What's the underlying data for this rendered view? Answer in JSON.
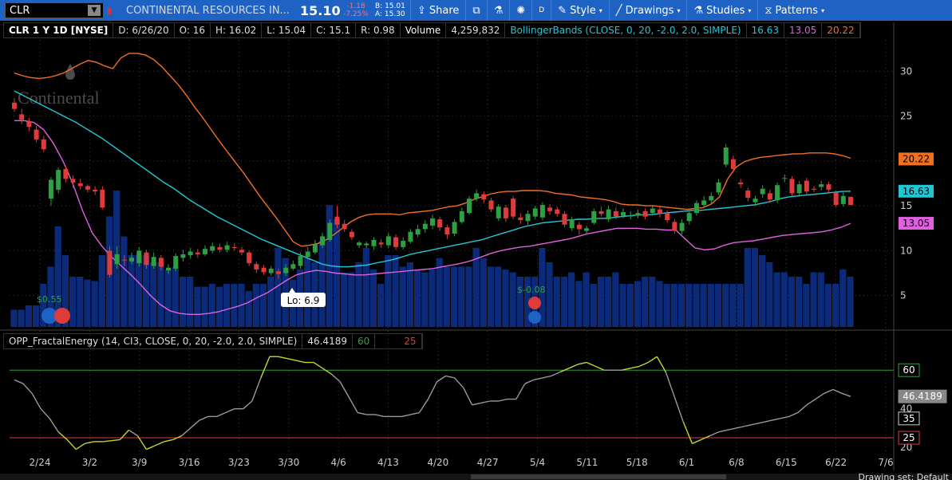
{
  "toolbar": {
    "symbol": "CLR",
    "company": "CONTINENTAL RESOURCES IN...",
    "last": "15.10",
    "change": "-1.18",
    "change_pct": "-7.25%",
    "bid": "B: 15.01",
    "ask": "A: 15.30",
    "share": "Share",
    "period": "D",
    "style": "Style",
    "drawings": "Drawings",
    "studies": "Studies",
    "patterns": "Patterns",
    "colors": {
      "toolbar_bg": "#1e62c4",
      "up": "#2ea043",
      "down": "#e03b3b"
    }
  },
  "infobar": {
    "title": "CLR 1 Y 1D [NYSE]",
    "date": "D: 6/26/20",
    "open": "O: 16",
    "high": "H: 16.02",
    "low": "L: 15.04",
    "close": "C: 15.1",
    "range": "R: 0.98",
    "volume_label": "Volume",
    "volume": "4,259,832",
    "bb_label": "BollingerBands (CLOSE, 0, 20, -2.0, 2.0, SIMPLE)",
    "bb_mid": "16.63",
    "bb_low": "13.05",
    "bb_high": "20.22"
  },
  "lower_study": {
    "label": "OPP_FractalEnergy (14, CI3, CLOSE, 0, 20, -2.0, 2.0, SIMPLE)",
    "value": "46.4189",
    "upper": "60",
    "lower": "25"
  },
  "annotations": {
    "low_bubble": "Lo: 6.9",
    "div1": "$0.55",
    "div2": "$-0.08"
  },
  "bottom": {
    "drawing_set": "Drawing set: Default"
  },
  "chart_data": {
    "type": "candlestick",
    "x_ticks": [
      "2/24",
      "3/2",
      "3/9",
      "3/16",
      "3/23",
      "3/30",
      "4/6",
      "4/13",
      "4/20",
      "4/27",
      "5/4",
      "5/11",
      "5/18",
      "6/1",
      "6/8",
      "6/15",
      "6/22",
      "7/6"
    ],
    "y_ticks": [
      5,
      10,
      15,
      20,
      25,
      30
    ],
    "ylim": [
      1.5,
      33.5
    ],
    "candles": [
      {
        "o": 26.5,
        "c": 25.8,
        "h": 27,
        "l": 25.5
      },
      {
        "o": 25.2,
        "c": 24.6,
        "h": 25.8,
        "l": 24.1
      },
      {
        "o": 24.4,
        "c": 23.8,
        "h": 24.8,
        "l": 23.3
      },
      {
        "o": 23.5,
        "c": 22.4,
        "h": 23.9,
        "l": 22.1
      },
      {
        "o": 22.4,
        "c": 21.3,
        "h": 22.8,
        "l": 21
      },
      {
        "o": 15.8,
        "c": 17.9,
        "h": 18.2,
        "l": 15
      },
      {
        "o": 16.8,
        "c": 19,
        "h": 19.3,
        "l": 16.4
      },
      {
        "o": 19.1,
        "c": 18,
        "h": 19.5,
        "l": 17.6
      },
      {
        "o": 18,
        "c": 17.6,
        "h": 18.4,
        "l": 17
      },
      {
        "o": 17.5,
        "c": 17.2,
        "h": 18,
        "l": 16.8
      },
      {
        "o": 17.2,
        "c": 16.8,
        "h": 17.4,
        "l": 16.5
      },
      {
        "o": 16.8,
        "c": 16.6,
        "h": 17.2,
        "l": 16.2
      },
      {
        "o": 16.8,
        "c": 14.8,
        "h": 17.2,
        "l": 14.6
      },
      {
        "o": 10,
        "c": 7.3,
        "h": 10.5,
        "l": 7
      },
      {
        "o": 8.5,
        "c": 9.6,
        "h": 10.5,
        "l": 8
      },
      {
        "o": 9,
        "c": 8.9,
        "h": 9.5,
        "l": 8.3
      },
      {
        "o": 8.8,
        "c": 9.2,
        "h": 9.8,
        "l": 8.5
      },
      {
        "o": 8.6,
        "c": 10,
        "h": 10.4,
        "l": 8.2
      },
      {
        "o": 9.8,
        "c": 8.4,
        "h": 10.1,
        "l": 8
      },
      {
        "o": 8.3,
        "c": 9.3,
        "h": 9.8,
        "l": 8
      },
      {
        "o": 9.2,
        "c": 8.2,
        "h": 9.5,
        "l": 7.8
      },
      {
        "o": 7.8,
        "c": 8.1,
        "h": 8.5,
        "l": 7.4
      },
      {
        "o": 8,
        "c": 9.4,
        "h": 9.7,
        "l": 7.7
      },
      {
        "o": 9.2,
        "c": 9.6,
        "h": 10.1,
        "l": 8.8
      },
      {
        "o": 9.5,
        "c": 9.9,
        "h": 10.3,
        "l": 9.1
      },
      {
        "o": 9.8,
        "c": 9.6,
        "h": 10.2,
        "l": 9.2
      },
      {
        "o": 9.6,
        "c": 10.2,
        "h": 10.6,
        "l": 9.4
      },
      {
        "o": 10,
        "c": 10.5,
        "h": 10.9,
        "l": 9.7
      },
      {
        "o": 10.4,
        "c": 10.1,
        "h": 10.8,
        "l": 9.8
      },
      {
        "o": 10.1,
        "c": 10.6,
        "h": 11,
        "l": 9.8
      },
      {
        "o": 10.4,
        "c": 10.3,
        "h": 10.8,
        "l": 10
      },
      {
        "o": 10.1,
        "c": 9.8,
        "h": 10.4,
        "l": 9.5
      },
      {
        "o": 9.8,
        "c": 8.6,
        "h": 10,
        "l": 8.3
      },
      {
        "o": 8.5,
        "c": 7.9,
        "h": 8.8,
        "l": 7.5
      },
      {
        "o": 8.1,
        "c": 7.6,
        "h": 8.4,
        "l": 7.3
      },
      {
        "o": 7.5,
        "c": 8,
        "h": 8.3,
        "l": 7.2
      },
      {
        "o": 7.7,
        "c": 7.4,
        "h": 8,
        "l": 6.9
      },
      {
        "o": 7.5,
        "c": 8.1,
        "h": 8.5,
        "l": 7.2
      },
      {
        "o": 8,
        "c": 8.5,
        "h": 8.9,
        "l": 7.8
      },
      {
        "o": 8.3,
        "c": 9.4,
        "h": 9.8,
        "l": 8
      },
      {
        "o": 9.3,
        "c": 9.9,
        "h": 10.4,
        "l": 9
      },
      {
        "o": 9.8,
        "c": 10.7,
        "h": 11.2,
        "l": 9.6
      },
      {
        "o": 10.6,
        "c": 11.6,
        "h": 12,
        "l": 10.3
      },
      {
        "o": 11.2,
        "c": 13.1,
        "h": 13.5,
        "l": 11
      },
      {
        "o": 13.8,
        "c": 12.9,
        "h": 15,
        "l": 12.5
      },
      {
        "o": 13,
        "c": 12.4,
        "h": 13.4,
        "l": 12.1
      },
      {
        "o": 12.1,
        "c": 11.5,
        "h": 12.4,
        "l": 11.2
      },
      {
        "o": 10.6,
        "c": 10.9,
        "h": 11.1,
        "l": 10.3
      },
      {
        "o": 10.6,
        "c": 10.8,
        "h": 11,
        "l": 10.3
      },
      {
        "o": 10.5,
        "c": 11.2,
        "h": 11.5,
        "l": 10.1
      },
      {
        "o": 10.9,
        "c": 10.7,
        "h": 11.3,
        "l": 10.3
      },
      {
        "o": 10.6,
        "c": 11.6,
        "h": 12,
        "l": 10.3
      },
      {
        "o": 11.5,
        "c": 10.4,
        "h": 11.8,
        "l": 10.1
      },
      {
        "o": 10.4,
        "c": 11.1,
        "h": 11.5,
        "l": 10.1
      },
      {
        "o": 11,
        "c": 12.1,
        "h": 12.4,
        "l": 10.8
      },
      {
        "o": 11.8,
        "c": 12.4,
        "h": 12.9,
        "l": 11.5
      },
      {
        "o": 12.4,
        "c": 13,
        "h": 13.4,
        "l": 12
      },
      {
        "o": 12.8,
        "c": 13.6,
        "h": 14,
        "l": 12.4
      },
      {
        "o": 13.5,
        "c": 12.6,
        "h": 13.8,
        "l": 12.2
      },
      {
        "o": 12.6,
        "c": 11.8,
        "h": 12.9,
        "l": 11.3
      },
      {
        "o": 11.9,
        "c": 13.2,
        "h": 13.5,
        "l": 11.6
      },
      {
        "o": 13.2,
        "c": 14.4,
        "h": 14.8,
        "l": 13
      },
      {
        "o": 14.2,
        "c": 15.8,
        "h": 16.1,
        "l": 14
      },
      {
        "o": 15.8,
        "c": 16.4,
        "h": 16.8,
        "l": 15.5
      },
      {
        "o": 16.3,
        "c": 15.7,
        "h": 16.6,
        "l": 15.3
      },
      {
        "o": 15.6,
        "c": 14.6,
        "h": 15.9,
        "l": 14.3
      },
      {
        "o": 13.6,
        "c": 14.9,
        "h": 15.2,
        "l": 13.3
      },
      {
        "o": 14.8,
        "c": 13.6,
        "h": 15.1,
        "l": 13.2
      },
      {
        "o": 15.8,
        "c": 13.8,
        "h": 16.1,
        "l": 13.5
      },
      {
        "o": 13.7,
        "c": 13.4,
        "h": 14.2,
        "l": 13
      },
      {
        "o": 13.3,
        "c": 14.1,
        "h": 14.5,
        "l": 12.9
      },
      {
        "o": 13.8,
        "c": 14.7,
        "h": 15,
        "l": 13.5
      },
      {
        "o": 13.7,
        "c": 15.1,
        "h": 15.4,
        "l": 13.4
      },
      {
        "o": 14.8,
        "c": 14.4,
        "h": 15.2,
        "l": 14
      },
      {
        "o": 14.6,
        "c": 14.1,
        "h": 14.9,
        "l": 13.8
      },
      {
        "o": 14.1,
        "c": 12.9,
        "h": 14.4,
        "l": 12.6
      },
      {
        "o": 12.5,
        "c": 13.5,
        "h": 13.8,
        "l": 12.2
      },
      {
        "o": 12.9,
        "c": 12.4,
        "h": 13.2,
        "l": 11.8
      },
      {
        "o": 12.2,
        "c": 12.5,
        "h": 12.8,
        "l": 11.9
      },
      {
        "o": 13.1,
        "c": 14.4,
        "h": 14.7,
        "l": 12.9
      },
      {
        "o": 14.4,
        "c": 14.1,
        "h": 14.9,
        "l": 13.8
      },
      {
        "o": 13.5,
        "c": 14.6,
        "h": 15,
        "l": 13.2
      },
      {
        "o": 14.4,
        "c": 13.8,
        "h": 14.8,
        "l": 13.5
      },
      {
        "o": 13.9,
        "c": 14.3,
        "h": 14.7,
        "l": 13.6
      },
      {
        "o": 13.9,
        "c": 13.9,
        "h": 14.4,
        "l": 13.5
      },
      {
        "o": 13.9,
        "c": 14.2,
        "h": 14.6,
        "l": 13.6
      },
      {
        "o": 14.4,
        "c": 13.8,
        "h": 14.7,
        "l": 13.5
      },
      {
        "o": 14.2,
        "c": 14.7,
        "h": 15.1,
        "l": 13.9
      },
      {
        "o": 14.6,
        "c": 14.1,
        "h": 14.9,
        "l": 13.7
      },
      {
        "o": 14.2,
        "c": 13.4,
        "h": 14.5,
        "l": 13.1
      },
      {
        "o": 13.2,
        "c": 12.2,
        "h": 13.5,
        "l": 11.9
      },
      {
        "o": 12.2,
        "c": 13.1,
        "h": 13.5,
        "l": 11.8
      },
      {
        "o": 13.3,
        "c": 14.2,
        "h": 14.6,
        "l": 12.9
      },
      {
        "o": 14.2,
        "c": 15.3,
        "h": 15.6,
        "l": 13.9
      },
      {
        "o": 15.1,
        "c": 15.6,
        "h": 16.1,
        "l": 14.8
      },
      {
        "o": 15.6,
        "c": 16.1,
        "h": 16.5,
        "l": 15.2
      },
      {
        "o": 16.5,
        "c": 17.6,
        "h": 18,
        "l": 16.2
      },
      {
        "o": 19.6,
        "c": 21.5,
        "h": 21.9,
        "l": 19.3
      },
      {
        "o": 20.2,
        "c": 19.1,
        "h": 20.6,
        "l": 18.7
      },
      {
        "o": 17.6,
        "c": 17.4,
        "h": 18,
        "l": 17
      },
      {
        "o": 16.7,
        "c": 15.9,
        "h": 17,
        "l": 15.5
      },
      {
        "o": 15.4,
        "c": 15.8,
        "h": 16.1,
        "l": 15
      },
      {
        "o": 16.3,
        "c": 16.9,
        "h": 17.3,
        "l": 15.9
      },
      {
        "o": 16.4,
        "c": 15.7,
        "h": 16.8,
        "l": 15.3
      },
      {
        "o": 15.6,
        "c": 17.3,
        "h": 17.6,
        "l": 15.3
      },
      {
        "o": 18.1,
        "c": 18.1,
        "h": 18.5,
        "l": 17.6
      },
      {
        "o": 18,
        "c": 16.4,
        "h": 18.3,
        "l": 16.1
      },
      {
        "o": 16.4,
        "c": 17.4,
        "h": 17.8,
        "l": 16
      },
      {
        "o": 17.8,
        "c": 16.6,
        "h": 18.1,
        "l": 16.2
      },
      {
        "o": 16.9,
        "c": 16.8,
        "h": 17.2,
        "l": 16.5
      },
      {
        "o": 17.1,
        "c": 17.4,
        "h": 17.8,
        "l": 16.7
      },
      {
        "o": 17.4,
        "c": 16.8,
        "h": 17.7,
        "l": 16.5
      },
      {
        "o": 16.5,
        "c": 15.1,
        "h": 16.7,
        "l": 14.9
      },
      {
        "o": 15.2,
        "c": 16.1,
        "h": 16.5,
        "l": 14.9
      },
      {
        "o": 16,
        "c": 15.1,
        "h": 16.02,
        "l": 15.04
      }
    ],
    "volume_rel": [
      0.12,
      0.12,
      0.15,
      0.15,
      0.3,
      0.42,
      0.7,
      0.5,
      0.35,
      0.35,
      0.33,
      0.32,
      0.5,
      0.77,
      0.95,
      0.63,
      0.5,
      0.5,
      0.5,
      0.45,
      0.45,
      0.4,
      0.42,
      0.35,
      0.35,
      0.28,
      0.28,
      0.3,
      0.28,
      0.3,
      0.3,
      0.3,
      0.25,
      0.3,
      0.3,
      0.35,
      0.55,
      0.48,
      0.33,
      0.4,
      0.48,
      0.45,
      0.6,
      0.85,
      0.75,
      0.38,
      0.38,
      0.45,
      0.55,
      0.4,
      0.3,
      0.5,
      0.5,
      0.42,
      0.45,
      0.4,
      0.38,
      0.4,
      0.48,
      0.42,
      0.42,
      0.42,
      0.42,
      0.55,
      0.48,
      0.42,
      0.42,
      0.4,
      0.38,
      0.35,
      0.35,
      0.35,
      0.55,
      0.45,
      0.35,
      0.35,
      0.38,
      0.32,
      0.38,
      0.3,
      0.35,
      0.35,
      0.38,
      0.3,
      0.3,
      0.32,
      0.35,
      0.35,
      0.32,
      0.3,
      0.3,
      0.3,
      0.3,
      0.3,
      0.3,
      0.3,
      0.3,
      0.3,
      0.3,
      0.3,
      0.55,
      0.55,
      0.5,
      0.45,
      0.38,
      0.38,
      0.35,
      0.35,
      0.3,
      0.38,
      0.38,
      0.3,
      0.3,
      0.4,
      0.35,
      0.38,
      0.55,
      0.38,
      0.32,
      0.38,
      0.3
    ],
    "bb_upper": [
      29.8,
      29.5,
      29.3,
      29.2,
      29.3,
      29.5,
      29.8,
      30.3,
      30.8,
      31.2,
      31,
      30.6,
      30.3,
      31.5,
      32,
      32,
      31.8,
      31.3,
      30.5,
      29.5,
      28.5,
      27.3,
      26,
      24.8,
      23.5,
      22.2,
      21,
      19.8,
      18.6,
      17.3,
      16,
      14.8,
      13.6,
      12.3,
      11,
      10.5,
      10.6,
      10.8,
      11.2,
      11.8,
      12.5,
      13.2,
      13.7,
      14,
      14.1,
      14.1,
      14.1,
      14,
      14.2,
      14.3,
      14.4,
      14.5,
      14.7,
      14.9,
      15,
      15.3,
      15.7,
      16,
      16.3,
      16.5,
      16.6,
      16.6,
      16.7,
      16.7,
      16.7,
      16.6,
      16.4,
      16.3,
      16.2,
      16,
      15.9,
      15.8,
      15.7,
      15.5,
      15.2,
      15.1,
      15.1,
      15,
      15,
      14.9,
      14.8,
      14.7,
      14.6,
      14.7,
      14.8,
      15.2,
      16,
      18,
      19.3,
      19.9,
      20.2,
      20.4,
      20.5,
      20.6,
      20.7,
      20.8,
      20.8,
      20.9,
      20.9,
      20.9,
      20.8,
      20.6,
      20.3
    ],
    "bb_mid": [
      27.8,
      27.3,
      26.8,
      26.3,
      25.8,
      25.3,
      24.8,
      24.3,
      23.7,
      23.1,
      22.5,
      21.8,
      21.1,
      20.4,
      19.7,
      19,
      18.3,
      17.6,
      17,
      16.3,
      15.6,
      15,
      14.4,
      13.8,
      13.3,
      12.8,
      12.3,
      11.8,
      11.3,
      10.9,
      10.5,
      10.1,
      9.7,
      9.3,
      8.9,
      8.5,
      8.3,
      8.2,
      8.2,
      8.3,
      8.4,
      8.6,
      8.8,
      9,
      9.3,
      9.6,
      9.8,
      10,
      10.2,
      10.4,
      10.6,
      10.8,
      11,
      11.2,
      11.5,
      11.8,
      12.1,
      12.4,
      12.7,
      12.9,
      13.1,
      13.2,
      13.3,
      13.4,
      13.5,
      13.5,
      13.6,
      13.6,
      13.7,
      13.8,
      13.9,
      14,
      14,
      14.1,
      14.2,
      14.3,
      14.4,
      14.5,
      14.5,
      14.6,
      14.7,
      14.8,
      14.9,
      15,
      15.1,
      15.3,
      15.5,
      15.8,
      16,
      16.1,
      16.2,
      16.3,
      16.4,
      16.5,
      16.6,
      16.63
    ],
    "bb_lower": [
      24.5,
      24.5,
      24.3,
      23.5,
      22,
      20,
      17.5,
      14.5,
      12,
      10.5,
      9.3,
      8.3,
      7.3,
      6.2,
      5,
      4,
      3.3,
      3,
      2.9,
      2.9,
      3,
      3.2,
      3.5,
      3.8,
      4.2,
      4.8,
      5.3,
      6,
      6.7,
      7.3,
      7.6,
      7.8,
      7.7,
      7.5,
      7.4,
      7.3,
      7.3,
      7.4,
      7.5,
      7.6,
      7.7,
      7.8,
      7.9,
      8,
      8.2,
      8.4,
      8.6,
      8.9,
      9.3,
      9.7,
      10,
      10.2,
      10.4,
      10.5,
      10.7,
      10.9,
      11.1,
      11.3,
      11.6,
      11.9,
      12.1,
      12.3,
      12.5,
      12.5,
      12.5,
      12.4,
      12.4,
      12.3,
      12.3,
      11.3,
      10.3,
      10.1,
      10.2,
      10.6,
      10.9,
      11,
      11.1,
      11.3,
      11.5,
      11.7,
      11.8,
      11.9,
      12,
      12.1,
      12.3,
      12.6,
      13.05
    ],
    "fe_ylim": [
      18,
      70
    ],
    "fe_lines": {
      "upper": 60,
      "lower": 25,
      "ticks": [
        20,
        35,
        40,
        60,
        25
      ]
    },
    "fractal_energy": [
      55,
      53,
      48,
      40,
      35,
      28,
      24,
      19,
      22,
      23,
      23,
      23.5,
      24,
      29,
      26,
      19,
      21,
      23,
      24,
      26,
      30,
      34,
      36,
      36,
      38,
      40,
      40,
      44,
      56,
      67,
      67,
      66,
      65,
      64,
      64,
      61,
      58,
      54,
      46,
      38,
      37,
      37,
      36,
      36,
      36,
      37,
      38,
      45,
      54,
      57,
      56,
      51,
      42,
      43,
      44,
      44,
      45,
      45,
      53,
      55,
      56,
      57,
      59,
      61,
      63,
      64,
      62,
      60,
      60,
      60,
      61,
      62,
      64,
      67,
      59,
      46,
      33,
      22,
      24,
      26,
      28,
      29,
      30,
      31,
      32,
      33,
      34,
      35,
      36,
      38,
      42,
      45,
      48,
      50,
      48,
      46.4
    ]
  }
}
